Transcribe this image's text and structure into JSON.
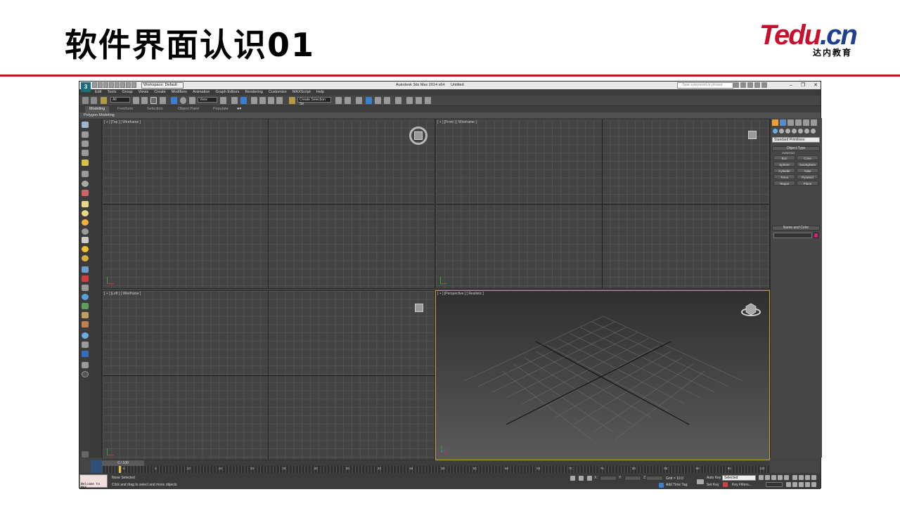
{
  "slide": {
    "title": "软件界面认识01",
    "logo_main_a": "Tedu",
    "logo_main_b": ".cn",
    "logo_sub": "达内教育"
  },
  "window": {
    "title": "Autodesk 3ds Max  2014 x64",
    "document": "Untitled",
    "workspace": "Workspace: Default",
    "search_placeholder": "Type a keyword or phrase",
    "min": "–",
    "restore": "❐",
    "close": "✕"
  },
  "menu": [
    "Edit",
    "Tools",
    "Group",
    "Views",
    "Create",
    "Modifiers",
    "Animation",
    "Graph Editors",
    "Rendering",
    "Customize",
    "MAXScript",
    "Help"
  ],
  "toolbar": {
    "selection_filter": "All",
    "ref_coord": "View",
    "named_selection": "Create Selection Se"
  },
  "ribbon": {
    "tabs": [
      "Modeling",
      "Freeform",
      "Selection",
      "Object Paint",
      "Populate"
    ],
    "active": "Modeling",
    "subpanel": "Polygon Modeling"
  },
  "viewports": {
    "top": "[ + ] [Top ] [ Wireframe ]",
    "front": "[ + ] [Front ] [ Wireframe ]",
    "left": "[ + ] [Left ] [ Wireframe ]",
    "perspective": "[ + ] [Perspective ] [ Realistic ]"
  },
  "command_panel": {
    "category": "Standard Primitives",
    "object_type_header": "Object Type",
    "autogrid": "AutoGrid",
    "primitives": [
      "Box",
      "Cone",
      "Sphere",
      "GeoSphere",
      "Cylinder",
      "Tube",
      "Torus",
      "Pyramid",
      "Teapot",
      "Plane"
    ],
    "name_color_header": "Name and Color",
    "object_color": "#c8267f"
  },
  "timeline": {
    "slider": "0 / 100",
    "ticks": [
      "0",
      "5",
      "10",
      "15",
      "20",
      "25",
      "30",
      "35",
      "40",
      "45",
      "50",
      "55",
      "60",
      "65",
      "70",
      "75",
      "80",
      "85",
      "90",
      "95",
      "100"
    ]
  },
  "status": {
    "maxscript_output": "Welcome to MAX",
    "selection": "None Selected",
    "prompt": "Click and drag to select and move objects",
    "x_label": "X:",
    "y_label": "Y:",
    "z_label": "Z:",
    "grid": "Grid = 10.0",
    "add_time_tag": "Add Time Tag",
    "auto_key": "Auto Key",
    "set_key": "Set Key",
    "selected": "Selected",
    "key_filters": "Key Filters..."
  }
}
